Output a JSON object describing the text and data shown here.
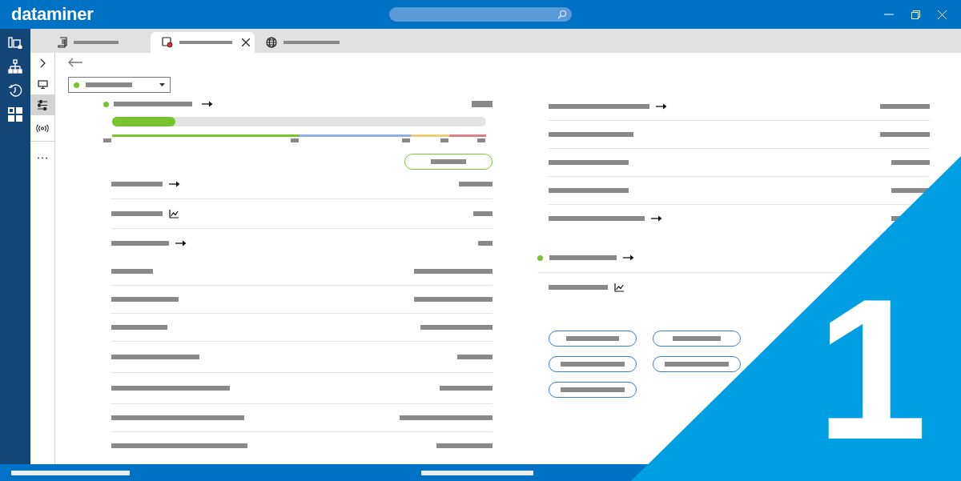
{
  "app": {
    "logo": "dataminer"
  },
  "search": {
    "kind": "search"
  },
  "sidebar": [
    {
      "kind": "apps"
    },
    {
      "kind": "tree"
    },
    {
      "kind": "history"
    },
    {
      "kind": "grid"
    }
  ],
  "subnav": [
    {
      "kind": "expand",
      "selected": false
    },
    {
      "kind": "monitor",
      "selected": false
    },
    {
      "kind": "sliders",
      "selected": true
    },
    {
      "kind": "antenna",
      "selected": false
    },
    {
      "kind": "more",
      "selected": false
    }
  ],
  "tabs": [
    {
      "kind": "document",
      "selected": false
    },
    {
      "kind": "element",
      "selected": true
    },
    {
      "kind": "globe",
      "selected": false
    }
  ],
  "status_dropdown": {
    "color": "#77c42e"
  },
  "main_parameter": {
    "color": "#77c42e",
    "level": 0.17,
    "ranges": [
      {
        "color": "#77c42e"
      },
      {
        "color": "#93aaee"
      },
      {
        "color": "#e8cf7a"
      },
      {
        "color": "#dd7e86"
      }
    ]
  },
  "left_rows": [
    {
      "kind": "arrow"
    },
    {
      "kind": "trend"
    },
    {
      "kind": "arrow"
    },
    {
      "kind": "plain"
    },
    {
      "kind": "plain"
    },
    {
      "kind": "plain"
    },
    {
      "kind": "plain"
    },
    {
      "kind": "plain"
    },
    {
      "kind": "plain"
    },
    {
      "kind": "plain"
    }
  ],
  "right_rows": [
    {
      "kind": "arrow"
    },
    {
      "kind": "plain"
    },
    {
      "kind": "plain"
    },
    {
      "kind": "plain"
    },
    {
      "kind": "arrow"
    }
  ],
  "right_group": [
    {
      "kind": "arrow",
      "color": "#77c42e"
    },
    {
      "kind": "trend"
    }
  ],
  "buttons": [
    {
      "kind": "short"
    },
    {
      "kind": "short"
    },
    {
      "kind": "long"
    },
    {
      "kind": "long"
    },
    {
      "kind": "long"
    }
  ],
  "corner_badge": "1"
}
